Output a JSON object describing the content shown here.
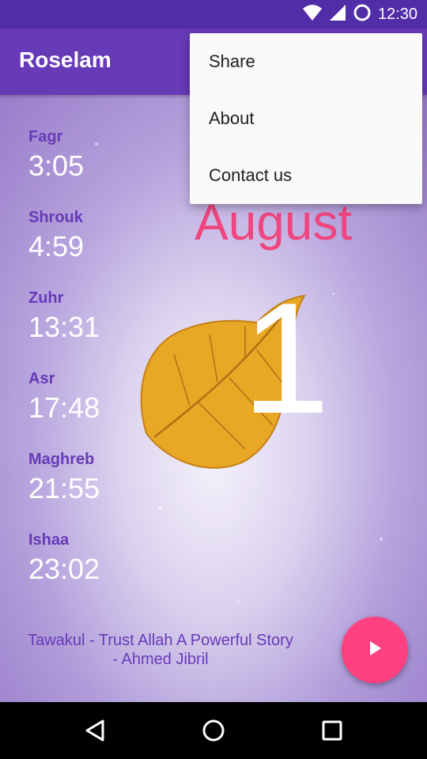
{
  "status_bar": {
    "time": "12:30"
  },
  "app_bar": {
    "title": "Roselam"
  },
  "menu": {
    "items": [
      "Share",
      "About",
      "Contact us"
    ]
  },
  "date": {
    "month": "August",
    "day": "1"
  },
  "prayers": [
    {
      "name": "Fagr",
      "time": "3:05"
    },
    {
      "name": "Shrouk",
      "time": "4:59"
    },
    {
      "name": "Zuhr",
      "time": "13:31"
    },
    {
      "name": "Asr",
      "time": "17:48"
    },
    {
      "name": "Maghreb",
      "time": "21:55"
    },
    {
      "name": "Ishaa",
      "time": "23:02"
    }
  ],
  "track": {
    "line1": "Tawakul - Trust Allah A Powerful Story",
    "line2": "- Ahmed Jibril"
  },
  "icons": {
    "wifi": "wifi-icon",
    "signal": "signal-icon",
    "battery": "battery-icon",
    "play": "play-icon",
    "back": "back-icon",
    "home": "home-icon",
    "recents": "recents-icon"
  },
  "colors": {
    "primary": "#673AB7",
    "primary_dark": "#512DA8",
    "accent": "#FF4081",
    "month": "#F0457E"
  }
}
